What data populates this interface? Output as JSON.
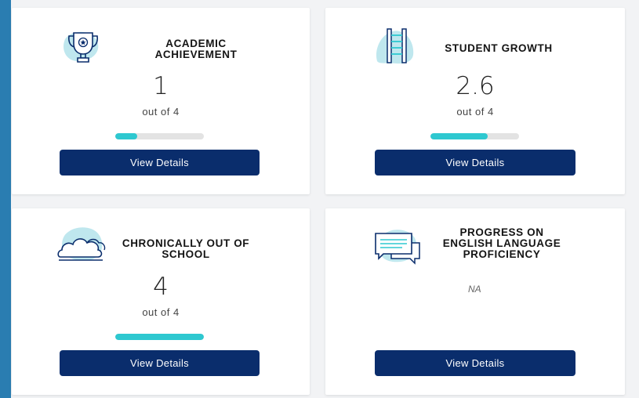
{
  "cards": [
    {
      "title": "ACADEMIC ACHIEVEMENT",
      "score": "1",
      "out_of": "out of 4",
      "progress_fraction": 0.25,
      "button_label": "View Details",
      "icon": "trophy-icon"
    },
    {
      "title": "STUDENT GROWTH",
      "score": "2.6",
      "out_of": "out of 4",
      "progress_fraction": 0.65,
      "button_label": "View Details",
      "icon": "ladder-icon"
    },
    {
      "title": "CHRONICALLY OUT OF SCHOOL",
      "score": "4",
      "out_of": "out of 4",
      "progress_fraction": 1.0,
      "button_label": "View Details",
      "icon": "cloud-icon"
    },
    {
      "title": "PROGRESS ON ENGLISH LANGUAGE PROFICIENCY",
      "na_text": "NA",
      "button_label": "View Details",
      "icon": "chat-bubbles-icon"
    }
  ],
  "colors": {
    "accent_teal": "#2ec8d0",
    "button_navy": "#0a2d6c",
    "icon_blob": "#bfe7ee",
    "sidebar_blue": "#2a7db1"
  }
}
